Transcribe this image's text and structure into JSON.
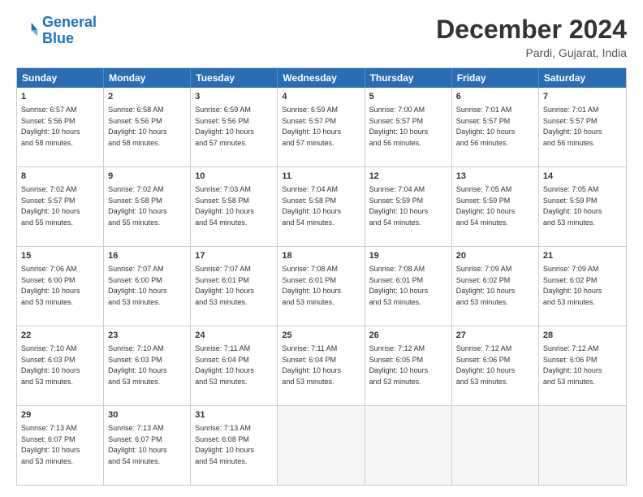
{
  "header": {
    "logo_line1": "General",
    "logo_line2": "Blue",
    "month_title": "December 2024",
    "location": "Pardi, Gujarat, India"
  },
  "weekdays": [
    "Sunday",
    "Monday",
    "Tuesday",
    "Wednesday",
    "Thursday",
    "Friday",
    "Saturday"
  ],
  "rows": [
    [
      {
        "day": "1",
        "text": "Sunrise: 6:57 AM\nSunset: 5:56 PM\nDaylight: 10 hours\nand 58 minutes."
      },
      {
        "day": "2",
        "text": "Sunrise: 6:58 AM\nSunset: 5:56 PM\nDaylight: 10 hours\nand 58 minutes."
      },
      {
        "day": "3",
        "text": "Sunrise: 6:59 AM\nSunset: 5:56 PM\nDaylight: 10 hours\nand 57 minutes."
      },
      {
        "day": "4",
        "text": "Sunrise: 6:59 AM\nSunset: 5:57 PM\nDaylight: 10 hours\nand 57 minutes."
      },
      {
        "day": "5",
        "text": "Sunrise: 7:00 AM\nSunset: 5:57 PM\nDaylight: 10 hours\nand 56 minutes."
      },
      {
        "day": "6",
        "text": "Sunrise: 7:01 AM\nSunset: 5:57 PM\nDaylight: 10 hours\nand 56 minutes."
      },
      {
        "day": "7",
        "text": "Sunrise: 7:01 AM\nSunset: 5:57 PM\nDaylight: 10 hours\nand 56 minutes."
      }
    ],
    [
      {
        "day": "8",
        "text": "Sunrise: 7:02 AM\nSunset: 5:57 PM\nDaylight: 10 hours\nand 55 minutes."
      },
      {
        "day": "9",
        "text": "Sunrise: 7:02 AM\nSunset: 5:58 PM\nDaylight: 10 hours\nand 55 minutes."
      },
      {
        "day": "10",
        "text": "Sunrise: 7:03 AM\nSunset: 5:58 PM\nDaylight: 10 hours\nand 54 minutes."
      },
      {
        "day": "11",
        "text": "Sunrise: 7:04 AM\nSunset: 5:58 PM\nDaylight: 10 hours\nand 54 minutes."
      },
      {
        "day": "12",
        "text": "Sunrise: 7:04 AM\nSunset: 5:59 PM\nDaylight: 10 hours\nand 54 minutes."
      },
      {
        "day": "13",
        "text": "Sunrise: 7:05 AM\nSunset: 5:59 PM\nDaylight: 10 hours\nand 54 minutes."
      },
      {
        "day": "14",
        "text": "Sunrise: 7:05 AM\nSunset: 5:59 PM\nDaylight: 10 hours\nand 53 minutes."
      }
    ],
    [
      {
        "day": "15",
        "text": "Sunrise: 7:06 AM\nSunset: 6:00 PM\nDaylight: 10 hours\nand 53 minutes."
      },
      {
        "day": "16",
        "text": "Sunrise: 7:07 AM\nSunset: 6:00 PM\nDaylight: 10 hours\nand 53 minutes."
      },
      {
        "day": "17",
        "text": "Sunrise: 7:07 AM\nSunset: 6:01 PM\nDaylight: 10 hours\nand 53 minutes."
      },
      {
        "day": "18",
        "text": "Sunrise: 7:08 AM\nSunset: 6:01 PM\nDaylight: 10 hours\nand 53 minutes."
      },
      {
        "day": "19",
        "text": "Sunrise: 7:08 AM\nSunset: 6:01 PM\nDaylight: 10 hours\nand 53 minutes."
      },
      {
        "day": "20",
        "text": "Sunrise: 7:09 AM\nSunset: 6:02 PM\nDaylight: 10 hours\nand 53 minutes."
      },
      {
        "day": "21",
        "text": "Sunrise: 7:09 AM\nSunset: 6:02 PM\nDaylight: 10 hours\nand 53 minutes."
      }
    ],
    [
      {
        "day": "22",
        "text": "Sunrise: 7:10 AM\nSunset: 6:03 PM\nDaylight: 10 hours\nand 53 minutes."
      },
      {
        "day": "23",
        "text": "Sunrise: 7:10 AM\nSunset: 6:03 PM\nDaylight: 10 hours\nand 53 minutes."
      },
      {
        "day": "24",
        "text": "Sunrise: 7:11 AM\nSunset: 6:04 PM\nDaylight: 10 hours\nand 53 minutes."
      },
      {
        "day": "25",
        "text": "Sunrise: 7:11 AM\nSunset: 6:04 PM\nDaylight: 10 hours\nand 53 minutes."
      },
      {
        "day": "26",
        "text": "Sunrise: 7:12 AM\nSunset: 6:05 PM\nDaylight: 10 hours\nand 53 minutes."
      },
      {
        "day": "27",
        "text": "Sunrise: 7:12 AM\nSunset: 6:06 PM\nDaylight: 10 hours\nand 53 minutes."
      },
      {
        "day": "28",
        "text": "Sunrise: 7:12 AM\nSunset: 6:06 PM\nDaylight: 10 hours\nand 53 minutes."
      }
    ],
    [
      {
        "day": "29",
        "text": "Sunrise: 7:13 AM\nSunset: 6:07 PM\nDaylight: 10 hours\nand 53 minutes."
      },
      {
        "day": "30",
        "text": "Sunrise: 7:13 AM\nSunset: 6:07 PM\nDaylight: 10 hours\nand 54 minutes."
      },
      {
        "day": "31",
        "text": "Sunrise: 7:13 AM\nSunset: 6:08 PM\nDaylight: 10 hours\nand 54 minutes."
      },
      {
        "day": "",
        "text": ""
      },
      {
        "day": "",
        "text": ""
      },
      {
        "day": "",
        "text": ""
      },
      {
        "day": "",
        "text": ""
      }
    ]
  ]
}
